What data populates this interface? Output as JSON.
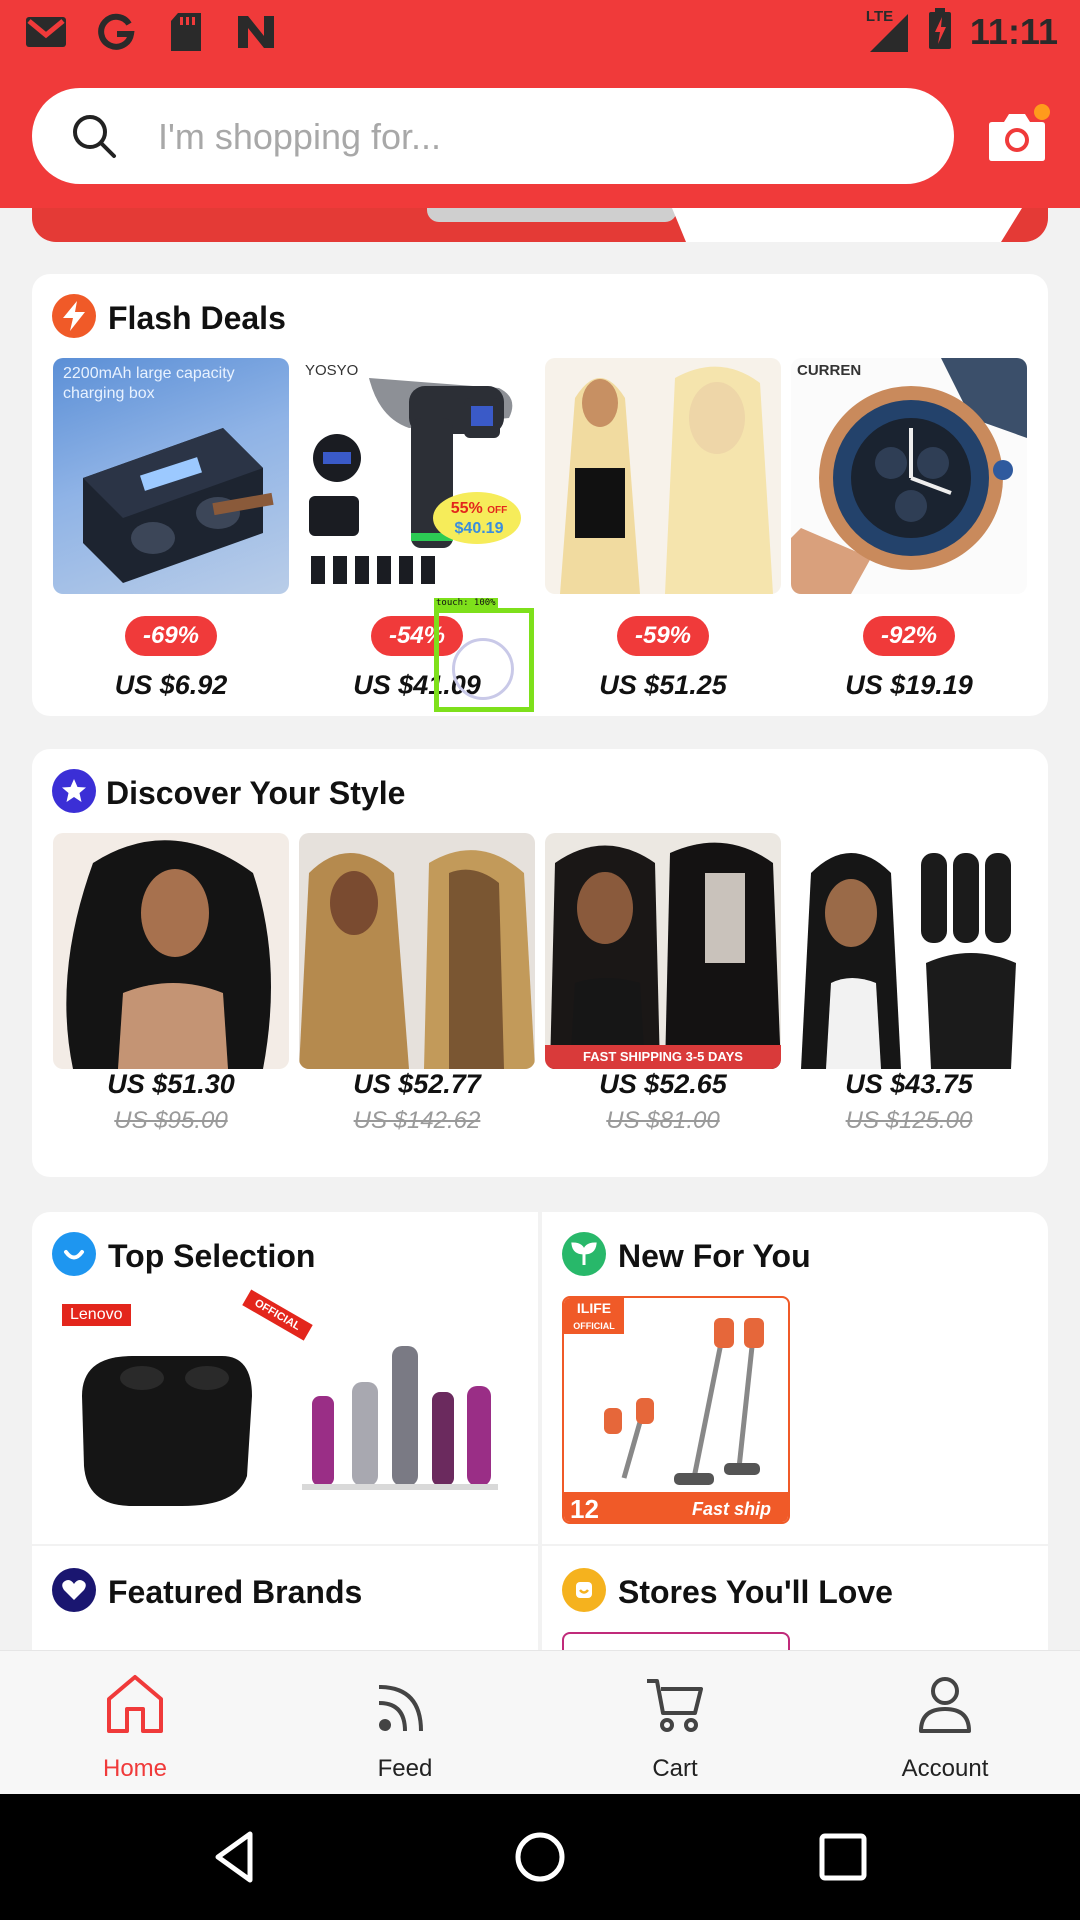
{
  "status_bar": {
    "time": "11:11",
    "network": "LTE"
  },
  "search": {
    "placeholder": "I'm shopping for..."
  },
  "flash_deals": {
    "title": "Flash Deals",
    "items": [
      {
        "image_text": "2200mAh large capacity charging box",
        "discount": "-69%",
        "price": "US $6.92"
      },
      {
        "image_brand": "YOSYO",
        "image_promo_pct": "55%",
        "image_promo_off": "OFF",
        "image_promo_price": "$40.19",
        "discount": "-54%",
        "price": "US $41.09"
      },
      {
        "discount": "-59%",
        "price": "US $51.25"
      },
      {
        "image_brand": "CURREN",
        "discount": "-92%",
        "price": "US $19.19"
      }
    ]
  },
  "touch_overlay": {
    "label": "touch: 100%"
  },
  "discover": {
    "title": "Discover Your Style",
    "items": [
      {
        "price": "US $51.30",
        "old_price": "US $95.00"
      },
      {
        "price": "US $52.77",
        "old_price": "US $142.62"
      },
      {
        "image_text": "FAST SHIPPING 3-5 DAYS",
        "price": "US $52.65",
        "old_price": "US $81.00"
      },
      {
        "price": "US $43.75",
        "old_price": "US $125.00"
      }
    ]
  },
  "top_selection": {
    "title": "Top Selection",
    "brand_tag": "Lenovo",
    "ribbon": "OFFICIAL"
  },
  "new_for_you": {
    "title": "New For You",
    "brand_tag": "ILIFE",
    "brand_sub": "OFFICIAL",
    "warranty": "12",
    "fast_ship": "Fast ship"
  },
  "featured_brands": {
    "title": "Featured Brands"
  },
  "stores": {
    "title": "Stores You'll Love"
  },
  "tabs": [
    {
      "label": "Home",
      "active": true
    },
    {
      "label": "Feed",
      "active": false
    },
    {
      "label": "Cart",
      "active": false
    },
    {
      "label": "Account",
      "active": false
    }
  ],
  "colors": {
    "brand_red": "#f03a3a",
    "active_tab": "#f03a3a",
    "touch_green": "#7ee01b"
  }
}
